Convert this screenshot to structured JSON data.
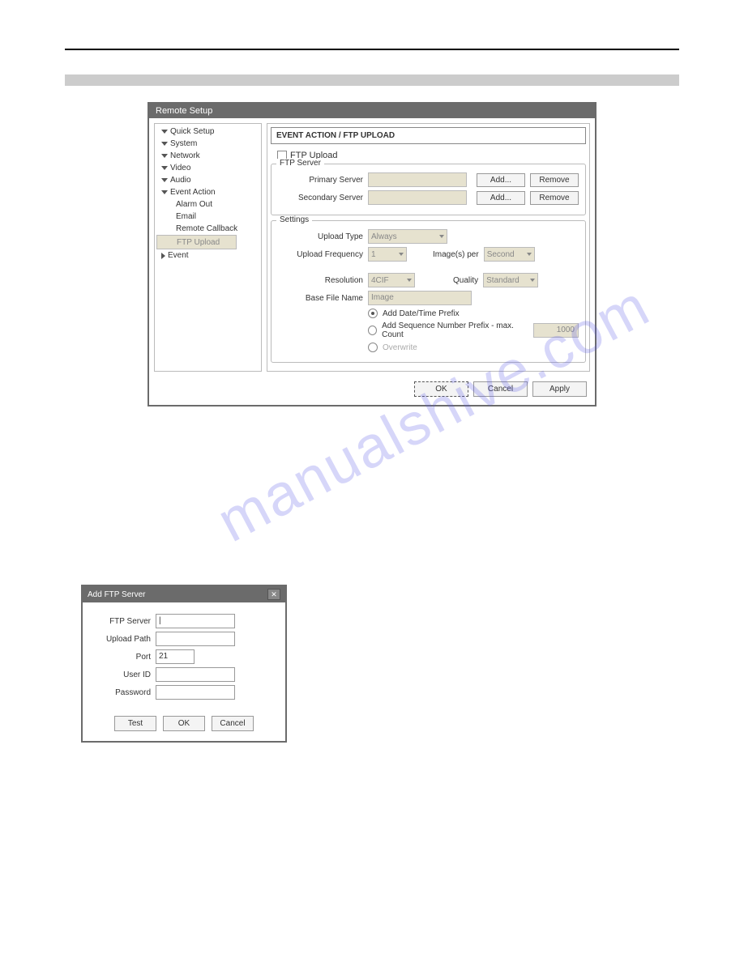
{
  "watermark": "manualshive.com",
  "dlg1": {
    "title": "Remote Setup",
    "tree": {
      "quick_setup": "Quick Setup",
      "system": "System",
      "network": "Network",
      "video": "Video",
      "audio": "Audio",
      "event_action": "Event Action",
      "alarm_out": "Alarm Out",
      "email": "Email",
      "remote_callback": "Remote Callback",
      "ftp_upload": "FTP Upload",
      "event": "Event"
    },
    "header": "EVENT ACTION / FTP UPLOAD",
    "ftp_upload_chk": "FTP Upload",
    "ftp_server": {
      "legend": "FTP Server",
      "primary": "Primary Server",
      "secondary": "Secondary Server",
      "add": "Add...",
      "remove": "Remove"
    },
    "settings": {
      "legend": "Settings",
      "upload_type_lbl": "Upload Type",
      "upload_type_val": "Always",
      "upload_freq_lbl": "Upload Frequency",
      "upload_freq_val": "1",
      "images_per": "Image(s) per",
      "images_per_val": "Second",
      "resolution_lbl": "Resolution",
      "resolution_val": "4CIF",
      "quality_lbl": "Quality",
      "quality_val": "Standard",
      "base_file_lbl": "Base File Name",
      "base_file_val": "Image",
      "radio1": "Add Date/Time Prefix",
      "radio2": "Add Sequence Number Prefix - max. Count",
      "radio2_val": "1000",
      "radio3": "Overwrite"
    },
    "buttons": {
      "ok": "OK",
      "cancel": "Cancel",
      "apply": "Apply"
    }
  },
  "dlg2": {
    "title": "Add FTP Server",
    "ftp_server": "FTP Server",
    "upload_path": "Upload Path",
    "port_lbl": "Port",
    "port_val": "21",
    "user_id": "User ID",
    "password": "Password",
    "test": "Test",
    "ok": "OK",
    "cancel": "Cancel"
  }
}
